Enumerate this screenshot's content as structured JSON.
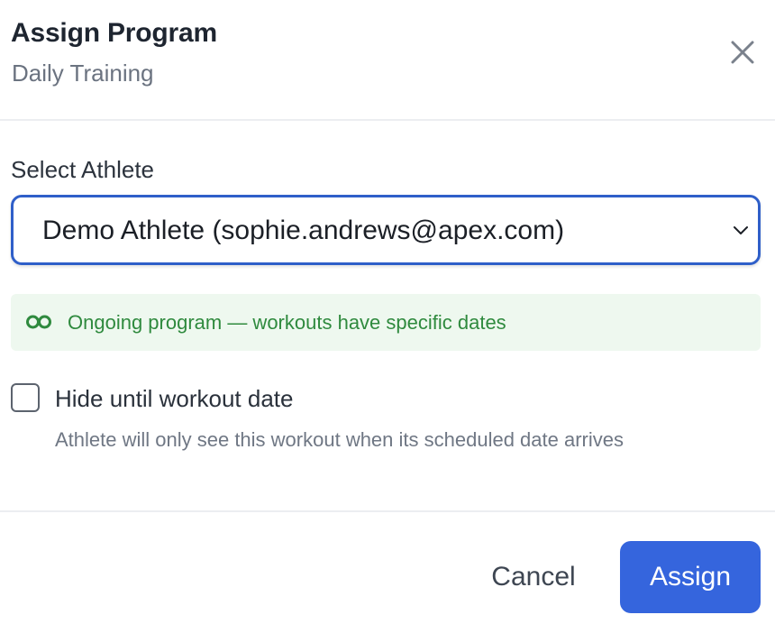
{
  "dialog": {
    "title": "Assign Program",
    "subtitle": "Daily Training",
    "close_icon": "close-icon"
  },
  "athlete_select": {
    "label": "Select Athlete",
    "selected_value": "Demo Athlete (sophie.andrews@apex.com)",
    "icon": "chevron-down-icon"
  },
  "info_banner": {
    "icon": "infinity-icon",
    "text": "Ongoing program — workouts have specific dates",
    "color": "#2f8a3e",
    "background": "#eef8ef"
  },
  "hide_option": {
    "checked": false,
    "label": "Hide until workout date",
    "help_text": "Athlete will only see this workout when its scheduled date arrives"
  },
  "footer": {
    "cancel_label": "Cancel",
    "assign_label": "Assign"
  },
  "colors": {
    "accent": "#3565dd",
    "select_border": "#2f5fc9"
  }
}
